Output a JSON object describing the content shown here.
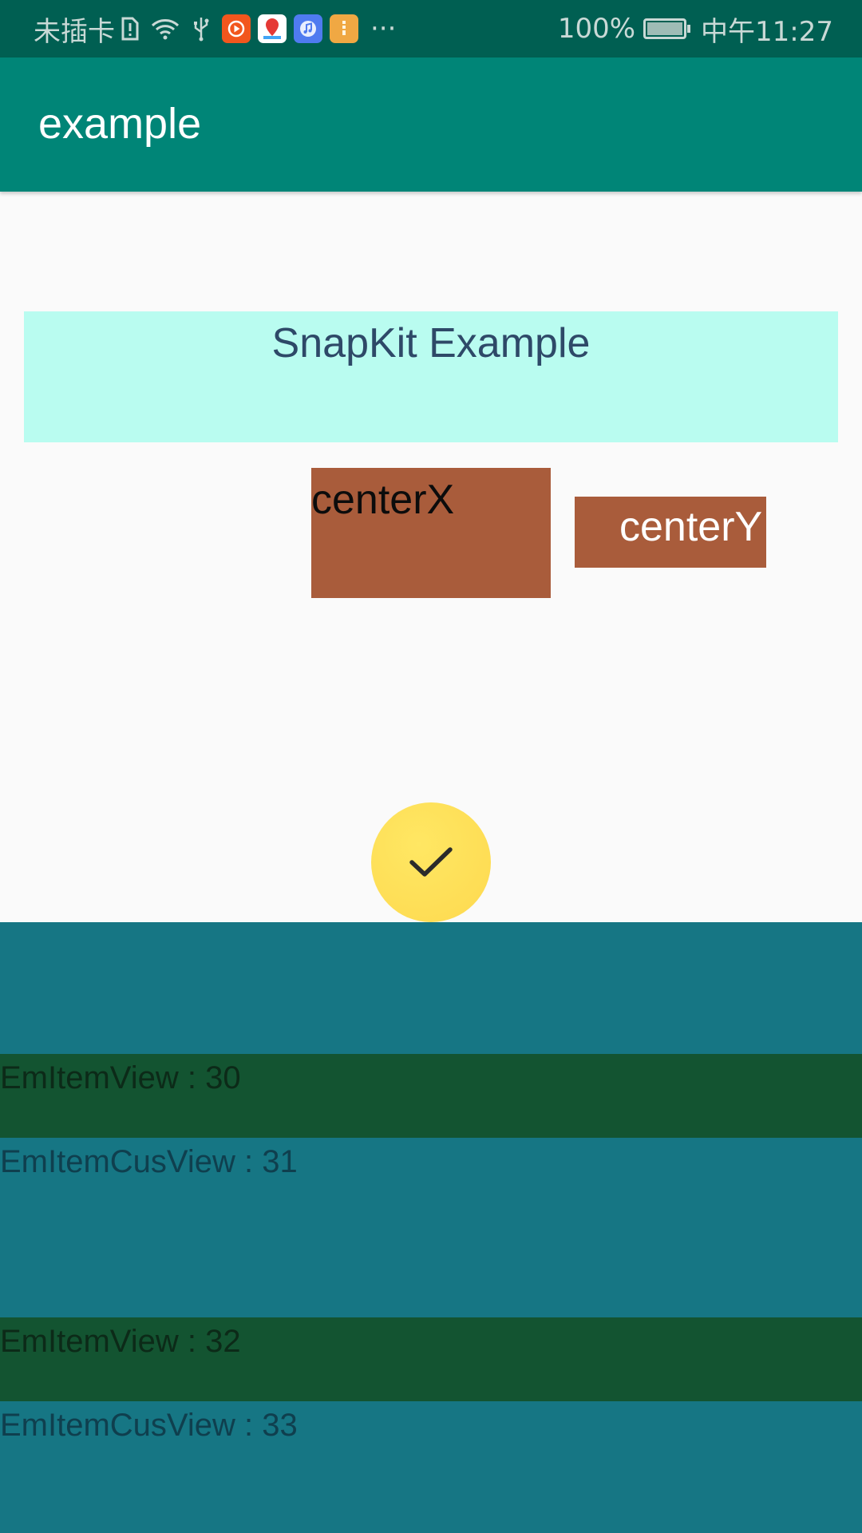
{
  "status_bar": {
    "carrier": "未插卡",
    "overflow": "···",
    "battery_pct": "100%",
    "time": "中午11:27",
    "icons": [
      "sim-alert-icon",
      "wifi-icon",
      "usb-icon",
      "video-app-icon",
      "maps-app-icon",
      "music-app-icon",
      "file-app-icon"
    ]
  },
  "app_bar": {
    "title": "example",
    "color": "#008577"
  },
  "main": {
    "banner_title": "SnapKit Example",
    "centerx_label": "centerX",
    "centery_label": "centerY",
    "fab_icon": "checkmark-icon"
  },
  "list": {
    "items": [
      {
        "label": "EmItemView : 30",
        "type": "view"
      },
      {
        "label": "EmItemCusView : 31",
        "type": "cus"
      },
      {
        "label": "EmItemView : 32",
        "type": "view"
      },
      {
        "label": "EmItemCusView : 33",
        "type": "cus"
      }
    ]
  },
  "colors": {
    "status_bar": "#005f52",
    "banner": "#b9fcf0",
    "box": "#a95c3b",
    "fab": "#fdd94f",
    "list_cus": "#167684",
    "list_view": "#135431"
  }
}
